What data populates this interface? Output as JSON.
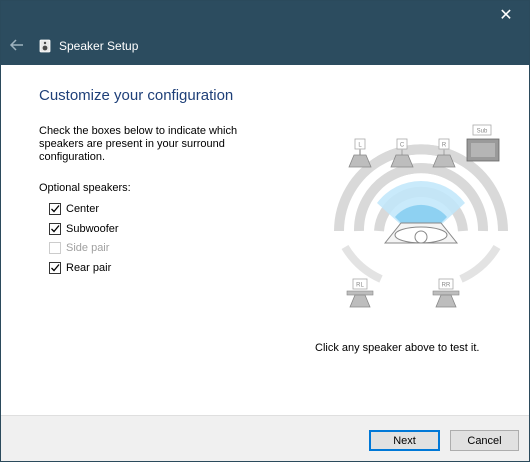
{
  "window": {
    "title": "Speaker Setup",
    "close_glyph": "✕",
    "back_glyph": "←"
  },
  "content": {
    "heading": "Customize your configuration",
    "description": "Check the boxes below to indicate which speakers are present in your surround configuration.",
    "optional_label": "Optional speakers:",
    "options": [
      {
        "label": "Center",
        "checked": true,
        "disabled": false
      },
      {
        "label": "Subwoofer",
        "checked": true,
        "disabled": false
      },
      {
        "label": "Side pair",
        "checked": false,
        "disabled": true
      },
      {
        "label": "Rear pair",
        "checked": true,
        "disabled": false
      }
    ],
    "hint": "Click any speaker above to test it."
  },
  "diagram": {
    "speakers": {
      "front_left": "L",
      "center": "C",
      "front_right": "R",
      "subwoofer": "Sub",
      "rear_left": "RL",
      "rear_right": "RR"
    },
    "accent_color": "#1fa0e0"
  },
  "footer": {
    "next_label": "Next",
    "cancel_label": "Cancel"
  },
  "colors": {
    "titlebar": "#2c4c5f",
    "heading": "#1e3f78",
    "button_focus": "#0078d7"
  }
}
